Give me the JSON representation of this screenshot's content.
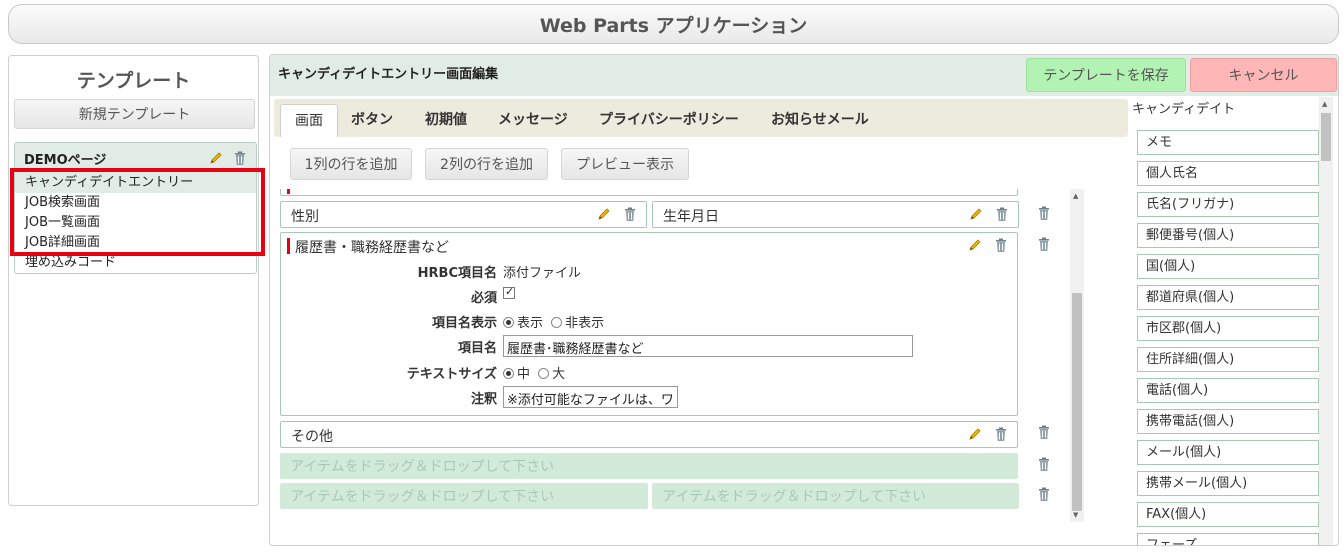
{
  "app": {
    "title": "Web Parts アプリケーション"
  },
  "sidebar": {
    "title": "テンプレート",
    "new_template_label": "新規テンプレート",
    "group": {
      "name": "DEMOページ",
      "items": [
        {
          "label": "キャンディデイトエントリー",
          "active": true
        },
        {
          "label": "JOB検索画面"
        },
        {
          "label": "JOB一覧画面"
        },
        {
          "label": "JOB詳細画面"
        },
        {
          "label": "埋め込みコード"
        }
      ]
    },
    "highlight_color": "#e60012"
  },
  "editor": {
    "title": "キャンディデイトエントリー画面編集",
    "save_label": "テンプレートを保存",
    "cancel_label": "キャンセル",
    "colors": {
      "save": "#b2f2b2",
      "cancel": "#ffb6b6",
      "accent": "#e1ece6"
    },
    "tabs": [
      {
        "label": "画面",
        "active": true
      },
      {
        "label": "ボタン"
      },
      {
        "label": "初期値"
      },
      {
        "label": "メッセージ"
      },
      {
        "label": "プライバシーポリシー"
      },
      {
        "label": "お知らせメール"
      }
    ],
    "actions": {
      "add_one_col": "1列の行を追加",
      "add_two_col": "2列の行を追加",
      "preview": "プレビュー表示"
    },
    "rows": {
      "gender": "性別",
      "birthdate": "生年月日",
      "resume": "履歴書・職務経歴書など",
      "other": "その他"
    },
    "resume_form": {
      "hrbc_label": "HRBC項目名",
      "hrbc_value": "添付ファイル",
      "required_label": "必須",
      "name_display_label": "項目名表示",
      "name_display_options": [
        "表示",
        "非表示"
      ],
      "item_name_label": "項目名",
      "item_name_value": "履歴書･職務経歴書など",
      "text_size_label": "テキストサイズ",
      "text_size_options": [
        "中",
        "大"
      ],
      "note_label": "注釈",
      "note_value": "※添付可能なファイルは、ワ"
    },
    "drop_placeholder": "アイテムをドラッグ＆ドロップして下さい"
  },
  "palette": {
    "title": "キャンディデイト",
    "items": [
      "メモ",
      "個人氏名",
      "氏名(フリガナ)",
      "郵便番号(個人)",
      "国(個人)",
      "都道府県(個人)",
      "市区郡(個人)",
      "住所詳細(個人)",
      "電話(個人)",
      "携帯電話(個人)",
      "メール(個人)",
      "携帯メール(個人)",
      "FAX(個人)",
      "フェーズ"
    ]
  },
  "icons": {
    "edit": "pencil-icon",
    "delete": "trash-icon"
  }
}
